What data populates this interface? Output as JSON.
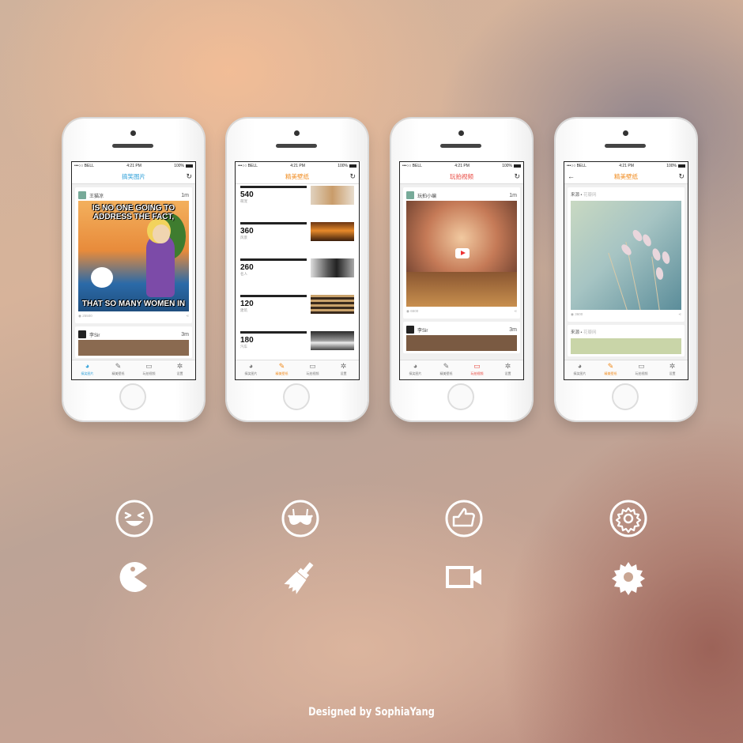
{
  "statusbar": {
    "carrier": "•••○○ BELL",
    "time": "4:21 PM",
    "battery": "100%"
  },
  "tabs": [
    "搞笑图片",
    "精美壁纸",
    "玩拍视频",
    "设置"
  ],
  "colors": {
    "funny": "#2fa0d9",
    "wallpaper": "#f08a1c",
    "video": "#e8453c",
    "inactive": "#777777"
  },
  "screens": [
    {
      "title": "搞笑图片",
      "post1": {
        "user": "王猫凉",
        "time": "1m",
        "meme_top": "IS NO ONE GOING TO ADDRESS THE FACT,",
        "meme_bottom": "THAT SO MANY WOMEN IN",
        "views": "25500"
      },
      "post2": {
        "user": "李Sir",
        "time": "3m"
      }
    },
    {
      "title": "精美壁纸",
      "categories": [
        {
          "count": "540",
          "label": "萌宠"
        },
        {
          "count": "360",
          "label": "风景"
        },
        {
          "count": "260",
          "label": "名人"
        },
        {
          "count": "120",
          "label": "建筑"
        },
        {
          "count": "180",
          "label": "汽车"
        }
      ]
    },
    {
      "title": "玩拍视频",
      "post1": {
        "user": "玩拍小编",
        "time": "1m",
        "views": "6500"
      },
      "post2": {
        "user": "李Sir",
        "time": "3m"
      }
    },
    {
      "title": "精美壁纸",
      "post1": {
        "source_label": "来源 •",
        "source_site": "花瓣网",
        "views": "3600"
      },
      "post2": {
        "source_label": "来源 •",
        "source_site": "花瓣网"
      }
    }
  ],
  "icons": [
    "laugh-face-icon",
    "bra-icon",
    "thumbs-up-icon",
    "settings-gear-icon",
    "pacman-icon",
    "paint-brush-icon",
    "video-camera-icon",
    "gear-icon"
  ],
  "footer": "Designed by SophiaYang"
}
